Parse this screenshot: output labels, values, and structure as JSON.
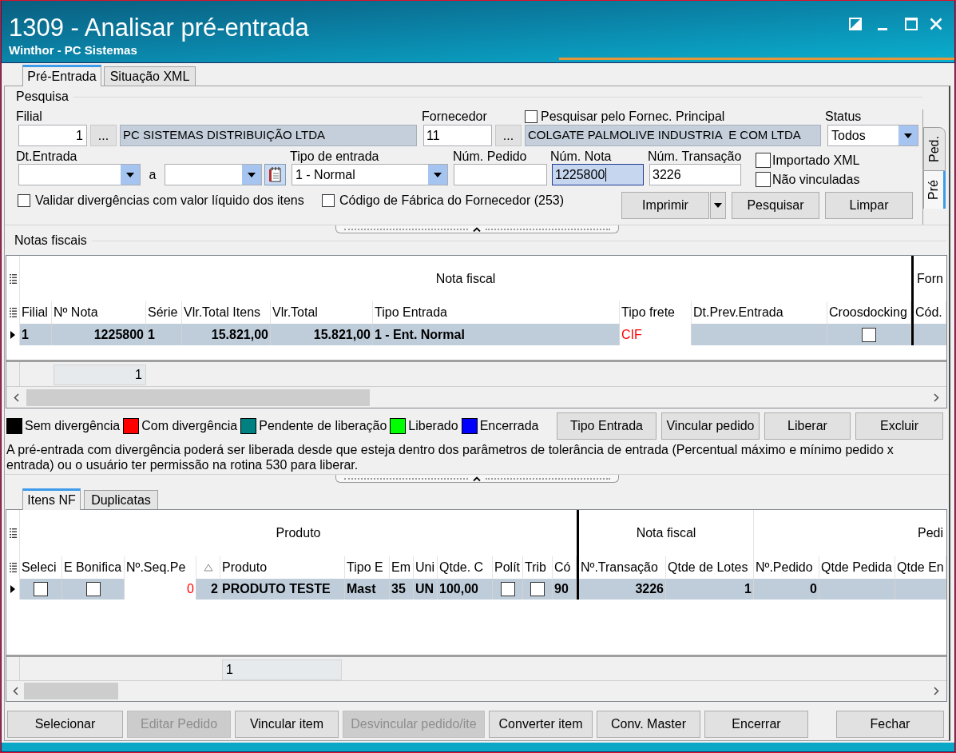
{
  "window": {
    "title": "1309 - Analisar pré-entrada",
    "subtitle": "Winthor - PC Sistemas"
  },
  "tabs": [
    {
      "label": "Pré-Entrada",
      "selected": true
    },
    {
      "label": "Situação XML",
      "selected": false
    }
  ],
  "search": {
    "title": "Pesquisa",
    "filial": {
      "label": "Filial",
      "code": "1",
      "browse": "...",
      "name": "PC SISTEMAS DISTRIBUIÇÃO LTDA"
    },
    "fornecedor": {
      "label": "Fornecedor",
      "code": "11",
      "browse": "...",
      "name": "COLGATE PALMOLIVE INDUSTRIA  E COM LTDA"
    },
    "principal": {
      "label": "Pesquisar pelo Fornec. Principal",
      "checked": false
    },
    "status": {
      "label": "Status",
      "value": "Todos"
    },
    "dt_entrada": {
      "label": "Dt.Entrada",
      "separator": "a"
    },
    "tipo_entrada": {
      "label": "Tipo de entrada",
      "value": "1 - Normal"
    },
    "num_pedido": {
      "label": "Núm. Pedido",
      "focused": false
    },
    "num_nota": {
      "label": "Núm. Nota",
      "value": "1225800",
      "focused": true
    },
    "num_transacao": {
      "label": "Núm. Transação",
      "value": "3226",
      "focused": false
    },
    "flags": [
      {
        "label": "Importado XML",
        "checked": false
      },
      {
        "label": "Não vinculadas",
        "checked": false
      }
    ],
    "options": [
      {
        "label": "Validar divergências com valor líquido dos itens",
        "checked": false
      },
      {
        "label": "Código de Fábrica do Fornecedor (253)",
        "checked": false
      }
    ],
    "buttons": [
      {
        "label": "Imprimir",
        "kind": "split"
      },
      {
        "label": "Pesquisar",
        "kind": "plain"
      },
      {
        "label": "Limpar",
        "kind": "plain"
      }
    ]
  },
  "side_tabs": [
    {
      "label": "Ped.",
      "selected": false
    },
    {
      "label": "Pré",
      "selected": true
    }
  ],
  "notas_fiscais": {
    "title": "Notas fiscais",
    "groups": [
      "Nota fiscal",
      "Forn"
    ],
    "columns": [
      {
        "label": "Filial"
      },
      {
        "label": "Nº Nota"
      },
      {
        "label": "Série"
      },
      {
        "label": "Vlr.Total Itens"
      },
      {
        "label": "Vlr.Total"
      },
      {
        "label": "Tipo Entrada"
      },
      {
        "label": "Tipo frete"
      },
      {
        "label": "Dt.Prev.Entrada"
      },
      {
        "label": "Croosdocking"
      },
      {
        "label": "Cód."
      }
    ],
    "rows": [
      {
        "selected": true,
        "cells": [
          {
            "text": "1",
            "highlight": false
          },
          {
            "text": "1225800",
            "highlight": false
          },
          {
            "text": "1",
            "highlight": false
          },
          {
            "text": "15.821,00",
            "highlight": false
          },
          {
            "text": "15.821,00",
            "highlight": false
          },
          {
            "text": "1 - Ent. Normal",
            "highlight": false
          },
          {
            "text": "CIF",
            "highlight": true
          },
          null,
          {
            "checked": false
          },
          null
        ]
      }
    ],
    "footer_value": "1"
  },
  "legend": [
    {
      "label": "Sem divergência",
      "color": "#000000"
    },
    {
      "label": "Com divergência",
      "color": "#ff0000"
    },
    {
      "label": "Pendente de liberação",
      "color": "#008080"
    },
    {
      "label": "Liberado",
      "color": "#00ff00"
    },
    {
      "label": "Encerrada",
      "color": "#0000ff"
    }
  ],
  "actions": [
    "Tipo Entrada",
    "Vincular pedido",
    "Liberar",
    "Excluir"
  ],
  "note": "A pré-entrada com divergência poderá ser liberada desde que esteja dentro dos parâmetros de tolerância de entrada (Percentual máximo e mínimo pedido x entrada) ou o usuário ter permissão na rotina 530 para liberar.",
  "item_tabs": [
    {
      "label": "Itens NF",
      "selected": true
    },
    {
      "label": "Duplicatas",
      "selected": false
    }
  ],
  "itens": {
    "groups": [
      "Produto",
      "Nota fiscal",
      "Pedi"
    ],
    "columns": [
      {
        "label": "Seleci",
        "sort_ascending": false
      },
      {
        "label": "E Bonifica",
        "sort_ascending": false
      },
      {
        "label": "Nº.Seq.Pe",
        "sort_ascending": false
      },
      {
        "sort_ascending": true
      },
      {
        "label": "Produto",
        "sort_ascending": false
      },
      {
        "label": "Tipo E",
        "sort_ascending": false
      },
      {
        "label": "Em",
        "sort_ascending": false
      },
      {
        "label": "Uni",
        "sort_ascending": false
      },
      {
        "label": "Qtde. C",
        "sort_ascending": false
      },
      {
        "label": "Polít",
        "sort_ascending": false
      },
      {
        "label": "Trib",
        "sort_ascending": false
      },
      {
        "label": "Có",
        "sort_ascending": false
      },
      {
        "label": "Nº.Transação",
        "sort_ascending": false
      },
      {
        "label": "Qtde de Lotes",
        "sort_ascending": false
      },
      {
        "label": "Nº.Pedido",
        "sort_ascending": false
      },
      {
        "label": "Qtde Pedida",
        "sort_ascending": false
      },
      {
        "label": "Qtde En",
        "sort_ascending": false
      }
    ],
    "rows": [
      {
        "selected": true,
        "cells": [
          {
            "checked": false
          },
          {
            "checked": false
          },
          {
            "text": "0",
            "highlight": true
          },
          {
            "text": "2",
            "highlight": false
          },
          {
            "text": "PRODUTO TESTE",
            "highlight": false
          },
          {
            "text": "Mast",
            "highlight": false
          },
          {
            "text": "35",
            "highlight": false
          },
          {
            "text": "UN",
            "highlight": false
          },
          {
            "text": "100,00",
            "highlight": false
          },
          {
            "checked": false
          },
          {
            "checked": false
          },
          {
            "text": "90",
            "highlight": false
          },
          {
            "text": "3226",
            "highlight": false
          },
          {
            "text": "1",
            "highlight": false
          },
          {
            "text": "0",
            "highlight": false
          },
          null,
          null
        ]
      }
    ],
    "footer_value": "1"
  },
  "bottom_buttons": [
    {
      "label": "Selecionar",
      "disabled": false
    },
    {
      "label": "Editar Pedido",
      "disabled": true
    },
    {
      "label": "Vincular item",
      "disabled": false
    },
    {
      "label": "Desvincular pedido/ite",
      "disabled": true
    },
    {
      "label": "Converter item",
      "disabled": false
    },
    {
      "label": "Conv. Master",
      "disabled": false
    },
    {
      "label": "Encerrar",
      "disabled": false
    },
    {
      "label": "Fechar",
      "disabled": false
    }
  ]
}
